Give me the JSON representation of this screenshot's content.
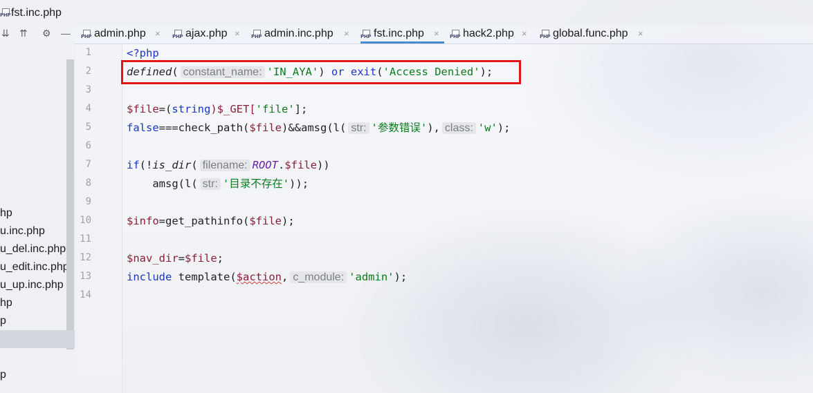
{
  "window": {
    "title": "fst.inc.php"
  },
  "sidebar": {
    "tools": [
      "⇊",
      "⇈",
      "⚙",
      "—"
    ],
    "items": [
      {
        "label": "hp"
      },
      {
        "label": "u.inc.php"
      },
      {
        "label": "u_del.inc.php"
      },
      {
        "label": "u_edit.inc.php"
      },
      {
        "label": "u_up.inc.php"
      },
      {
        "label": "hp"
      },
      {
        "label": "p"
      },
      {
        "label": "p"
      }
    ]
  },
  "tabs": [
    {
      "label": "admin.php",
      "active": false
    },
    {
      "label": "ajax.php",
      "active": false
    },
    {
      "label": "admin.inc.php",
      "active": false
    },
    {
      "label": "fst.inc.php",
      "active": true
    },
    {
      "label": "hack2.php",
      "active": false
    },
    {
      "label": "global.func.php",
      "active": false
    }
  ],
  "tab_close": "×",
  "line_numbers": [
    "1",
    "2",
    "3",
    "4",
    "5",
    "6",
    "7",
    "8",
    "9",
    "10",
    "11",
    "12",
    "13",
    "14"
  ],
  "code": {
    "l1": "<?php",
    "l2": {
      "fn": "defined",
      "p1": "(",
      "hint": "constant_name:",
      "arg": "'IN_AYA'",
      "p2": ") ",
      "kw1": "or",
      "sp": " ",
      "kw2": "exit",
      "p3": "(",
      "arg2": "'Access Denied'",
      "p4": ");"
    },
    "l4": {
      "var": "$file",
      "eq": "=(",
      "cast": "string",
      "rest": ")$_GET[",
      "key": "'file'",
      "end": "];"
    },
    "l5": {
      "kw": "false",
      "a": "===check_path(",
      "var": "$file",
      "b": ")&&amsg(l(",
      "hint1": "str:",
      "str1": "'参数错误'",
      "c": "),",
      "hint2": "class:",
      "str2": "'w'",
      "d": ");"
    },
    "l7": {
      "kw": "if",
      "a": "(!",
      "fn": "is_dir",
      "p": "(",
      "hint": "filename:",
      "const": "ROOT",
      "dot": ".",
      "var": "$file",
      "end": "))"
    },
    "l8": {
      "indent": "    ",
      "a": "amsg(l(",
      "hint": "str:",
      "str": "'目录不存在'",
      "end": "));"
    },
    "l10": {
      "var": "$info",
      "a": "=get_pathinfo(",
      "var2": "$file",
      "end": ");"
    },
    "l12": {
      "var": "$nav_dir",
      "a": "=",
      "var2": "$file",
      "end": ";"
    },
    "l13": {
      "kw": "include",
      "a": " template(",
      "var": "$action",
      "comma": ",",
      "hint": "c_module:",
      "str": "'admin'",
      "end": ");"
    }
  },
  "colors": {
    "keyword": "#1a36c6",
    "string": "#0a7a1c",
    "variable": "#8a1d34",
    "constant": "#6a1fa6",
    "highlight_box": "#e31414",
    "active_tab_underline": "#4a8bd6"
  },
  "icons": [
    "php-file-icon",
    "collapse-all-icon",
    "expand-all-icon",
    "gear-icon",
    "minimize-icon",
    "close-icon"
  ]
}
